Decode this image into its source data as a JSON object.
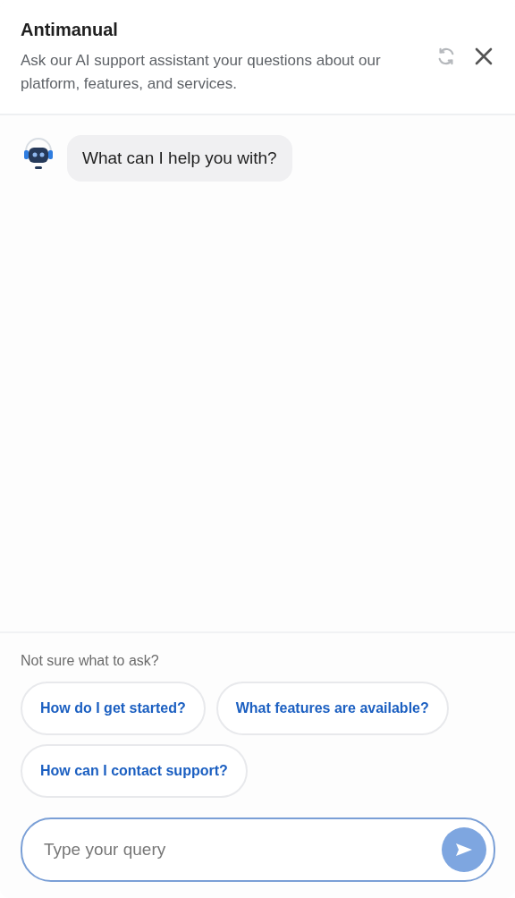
{
  "header": {
    "title": "Antimanual",
    "subtitle": "Ask our AI support assistant your questions about our platform, features, and services."
  },
  "messages": [
    {
      "kind": "assistant",
      "text": "What can I help you with?"
    }
  ],
  "suggestions": {
    "heading": "Not sure what to ask?",
    "items": [
      "How do I get started?",
      "What features are available?",
      "How can I contact support?"
    ]
  },
  "composer": {
    "placeholder": "Type your query",
    "send_disabled": true
  }
}
